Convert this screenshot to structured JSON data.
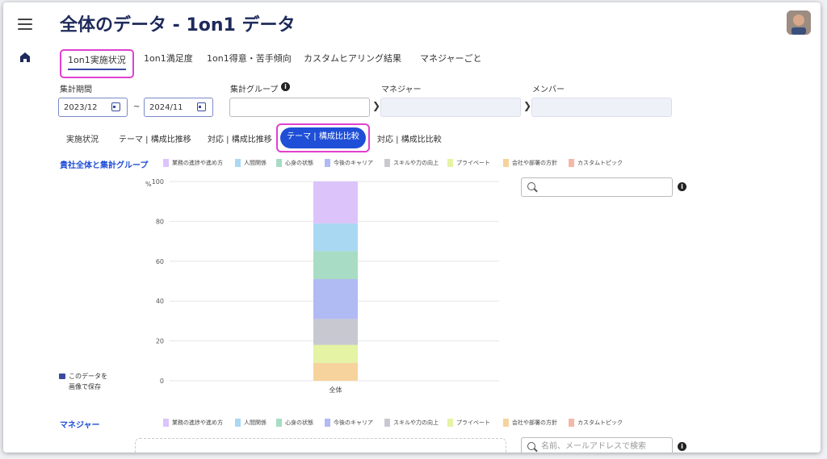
{
  "header": {
    "title": "全体のデータ - 1on1 データ"
  },
  "tabs": [
    {
      "label": "1on1実施状況"
    },
    {
      "label": "1on1満足度"
    },
    {
      "label": "1on1得意・苦手傾向"
    },
    {
      "label": "カスタムヒアリング結果"
    },
    {
      "label": "マネジャーごと"
    }
  ],
  "filters": {
    "period_label": "集計期間",
    "date_from": "2023/12",
    "date_sep": "~",
    "date_to": "2024/11",
    "group_label": "集計グループ",
    "manager_label": "マネジャー",
    "member_label": "メンバー"
  },
  "subtabs": [
    {
      "label": "実施状況"
    },
    {
      "label": "テーマ | 構成比推移"
    },
    {
      "label": "対応 | 構成比推移"
    },
    {
      "label": "テーマ | 構成比比較"
    },
    {
      "label": "対応 | 構成比比較"
    }
  ],
  "section1": {
    "title": "貴社全体と集計グループ"
  },
  "section2": {
    "title": "マネジャー",
    "search_placeholder": "名前、メールアドレスで検索"
  },
  "legend": [
    {
      "name": "業務の進捗や進め方",
      "color": "#dcc4fb"
    },
    {
      "name": "人間関係",
      "color": "#a9d8f3"
    },
    {
      "name": "心身の状態",
      "color": "#a8dcc4"
    },
    {
      "name": "今後のキャリア",
      "color": "#b0baf3"
    },
    {
      "name": "スキルや力の向上",
      "color": "#c8c9d0"
    },
    {
      "name": "プライベート",
      "color": "#e4f3a4"
    },
    {
      "name": "会社や部署の方針",
      "color": "#f6d39c"
    },
    {
      "name": "カスタムトピック",
      "color": "#f3b9a8"
    }
  ],
  "save_image": {
    "line1": "このデータを",
    "line2": "画像で保存"
  },
  "chart_data": {
    "type": "bar",
    "stacked": true,
    "categories": [
      "全体"
    ],
    "ylabel": "%",
    "ylim": [
      0,
      100
    ],
    "yticks": [
      "0",
      "20",
      "40",
      "60",
      "80",
      "100"
    ],
    "grid": true,
    "series": [
      {
        "name": "会社や部署の方針",
        "values": [
          9
        ]
      },
      {
        "name": "プライベート",
        "values": [
          9
        ]
      },
      {
        "name": "スキルや力の向上",
        "values": [
          13
        ]
      },
      {
        "name": "今後のキャリア",
        "values": [
          20
        ]
      },
      {
        "name": "心身の状態",
        "values": [
          14
        ]
      },
      {
        "name": "人間関係",
        "values": [
          14
        ]
      },
      {
        "name": "業務の進捗や進め方",
        "values": [
          21
        ]
      }
    ]
  }
}
